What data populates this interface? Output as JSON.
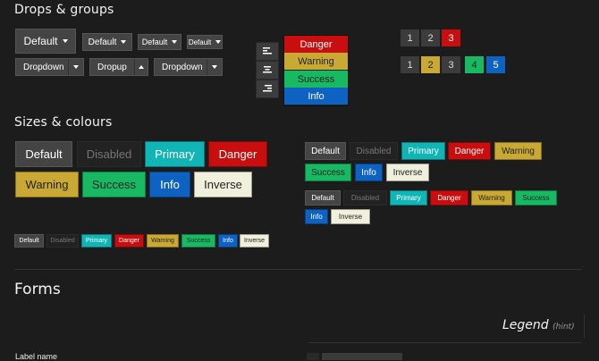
{
  "sections": {
    "drops_title": "Drops & groups",
    "sizes_title": "Sizes & colours",
    "forms_title": "Forms"
  },
  "drops": {
    "default_label": "Default",
    "dropdown_label": "Dropdown",
    "dropup_label": "Dropup",
    "menu": [
      "Danger",
      "Warning",
      "Success",
      "Info"
    ]
  },
  "pagination": {
    "row1": [
      "1",
      "2",
      "3"
    ],
    "row2": [
      "1",
      "2",
      "3",
      "4",
      "5"
    ]
  },
  "buttons": {
    "default": "Default",
    "disabled": "Disabled",
    "primary": "Primary",
    "danger": "Danger",
    "warning": "Warning",
    "success": "Success",
    "info": "Info",
    "inverse": "Inverse"
  },
  "legend": {
    "title": "Legend",
    "hint": "(hint)"
  },
  "form": {
    "label_name": "Label name"
  },
  "colors": {
    "background": "#1c1c1c",
    "default": "#444444",
    "primary": "#12b5b5",
    "danger": "#c80e0e",
    "warning": "#c9a934",
    "success": "#17ba63",
    "info": "#0e62c2",
    "inverse": "#f0f0dc"
  }
}
